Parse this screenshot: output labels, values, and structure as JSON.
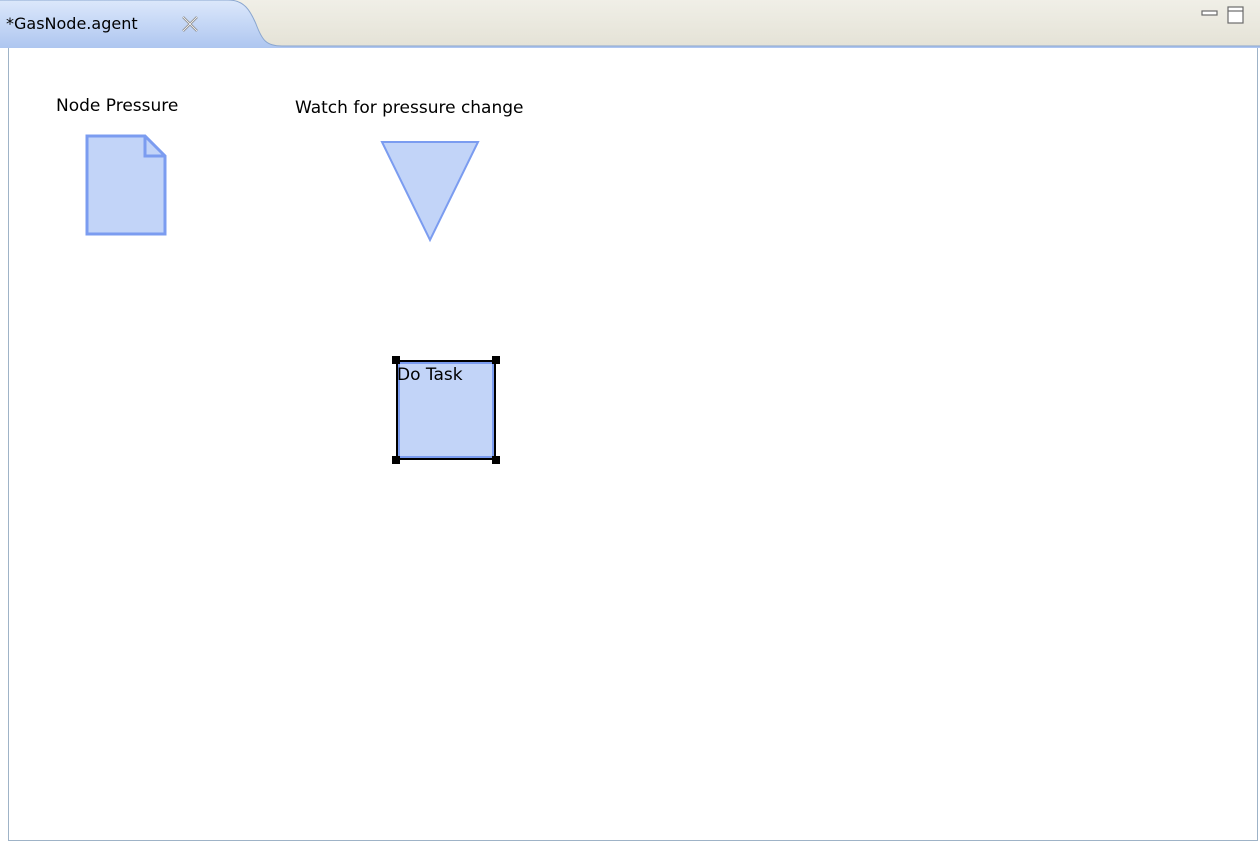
{
  "editor": {
    "tab_title": "*GasNode.agent",
    "tab_close_icon": "close-x-icon",
    "minimize_icon": "minimize-icon",
    "maximize_icon": "maximize-icon"
  },
  "diagram": {
    "node_pressure": {
      "label": "Node Pressure",
      "icon": "document-icon"
    },
    "watch_event": {
      "label": "Watch for pressure change",
      "icon": "triangle-down-icon"
    },
    "task": {
      "label": "Do Task",
      "selected": true
    }
  },
  "colors": {
    "shape_fill": "#c2d4f8",
    "shape_stroke": "#7b9cf0",
    "tab_active_fill": "#c9daf8",
    "frame_border": "#9fb3c7"
  }
}
